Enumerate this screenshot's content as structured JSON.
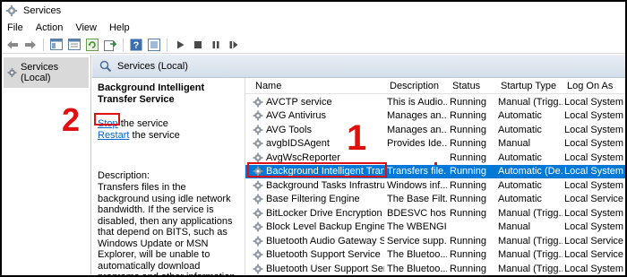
{
  "window": {
    "title": "Services"
  },
  "menu": [
    "File",
    "Action",
    "View",
    "Help"
  ],
  "toolbar": {
    "icons": [
      "back-arrow-icon",
      "forward-arrow-icon",
      "console-tree-icon",
      "properties-icon",
      "refresh-icon",
      "export-list-icon",
      "help-icon",
      "help-topics-icon",
      "play-icon",
      "stop-icon",
      "pause-icon",
      "restart-icon"
    ]
  },
  "tree": {
    "root": "Services (Local)"
  },
  "panel": {
    "header": "Services (Local)",
    "service_title": "Background Intelligent Transfer Service",
    "stop_link": "Stop",
    "stop_suffix": " the service",
    "restart_link": "Restart",
    "restart_suffix": " the service",
    "description_heading": "Description:",
    "description_text": "Transfers files in the background using idle network bandwidth. If the service is disabled, then any applications that depend on BITS, such as Windows Update or MSN Explorer, will be unable to automatically download programs and other information."
  },
  "table": {
    "columns": [
      "Name",
      "Description",
      "Status",
      "Startup Type",
      "Log On As"
    ],
    "rows": [
      {
        "name": "AVCTP service",
        "desc": "This is Audio...",
        "status": "Running",
        "startup": "Manual (Trigg...",
        "logon": "Local System"
      },
      {
        "name": "AVG Antivirus",
        "desc": "Manages an...",
        "status": "Running",
        "startup": "Automatic",
        "logon": "Local System"
      },
      {
        "name": "AVG Tools",
        "desc": "Manages an...",
        "status": "Running",
        "startup": "Automatic",
        "logon": "Local System"
      },
      {
        "name": "avgbIDSAgent",
        "desc": "Provides Ide...",
        "status": "Running",
        "startup": "Manual",
        "logon": "Local System"
      },
      {
        "name": "AvgWscReporter",
        "desc": "",
        "status": "Running",
        "startup": "Automatic",
        "logon": "Local System"
      },
      {
        "name": "Background Intelligent Tran...",
        "desc": "Transfers file...",
        "status": "Running",
        "startup": "Automatic (De...",
        "logon": "Local System"
      },
      {
        "name": "Background Tasks Infrastruc...",
        "desc": "Windows inf...",
        "status": "Running",
        "startup": "Automatic",
        "logon": "Local System"
      },
      {
        "name": "Base Filtering Engine",
        "desc": "The Base Filt...",
        "status": "Running",
        "startup": "Automatic",
        "logon": "Local Service"
      },
      {
        "name": "BitLocker Drive Encryption S...",
        "desc": "BDESVC hos...",
        "status": "Running",
        "startup": "Manual (Trigg...",
        "logon": "Local System"
      },
      {
        "name": "Block Level Backup Engine S...",
        "desc": "The WBENGI...",
        "status": "",
        "startup": "Manual",
        "logon": "Local System"
      },
      {
        "name": "Bluetooth Audio Gateway Se...",
        "desc": "Service supp...",
        "status": "Running",
        "startup": "Manual (Trigg...",
        "logon": "Local Service"
      },
      {
        "name": "Bluetooth Support Service",
        "desc": "The Bluetoo...",
        "status": "Running",
        "startup": "Manual (Trigg...",
        "logon": "Local Service"
      },
      {
        "name": "Bluetooth User Support Servi...",
        "desc": "The Bluetoo...",
        "status": "Running",
        "startup": "Manual (Trigg...",
        "logon": "Local System"
      }
    ],
    "selected_row": 5
  },
  "callouts": {
    "one": "1",
    "two": "2"
  },
  "colors": {
    "selection": "#0078d7",
    "callout": "#e01010",
    "link": "#0066cc"
  }
}
